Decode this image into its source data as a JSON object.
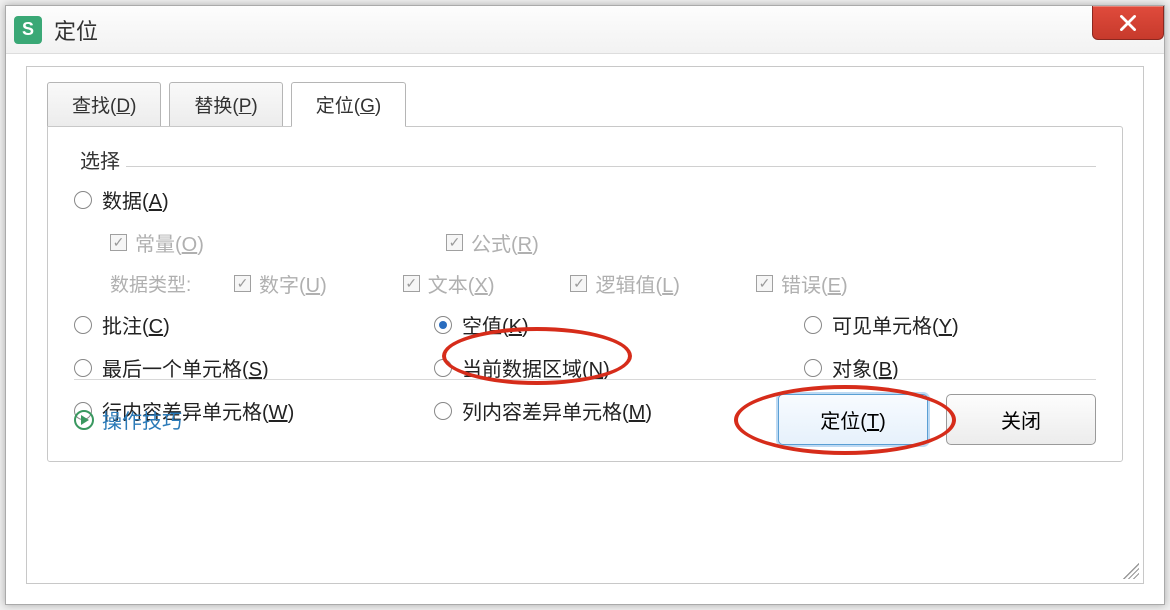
{
  "window": {
    "title": "定位",
    "app_icon_letter": "S"
  },
  "tabs": {
    "find": "查找(D)",
    "replace": "替换(P)",
    "goto": "定位(G)"
  },
  "group": {
    "label": "选择"
  },
  "options": {
    "data": "数据(A)",
    "constant": "常量(O)",
    "formula": "公式(R)",
    "dtype_label": "数据类型:",
    "number": "数字(U)",
    "text": "文本(X)",
    "logical": "逻辑值(L)",
    "error": "错误(E)",
    "comment": "批注(C)",
    "blank": "空值(K)",
    "visible": "可见单元格(Y)",
    "last_cell": "最后一个单元格(S)",
    "current_region": "当前数据区域(N)",
    "objects": "对象(B)",
    "row_diff": "行内容差异单元格(W)",
    "col_diff": "列内容差异单元格(M)"
  },
  "footer": {
    "tips": "操作技巧",
    "goto_btn": "定位(T)",
    "close_btn": "关闭"
  }
}
